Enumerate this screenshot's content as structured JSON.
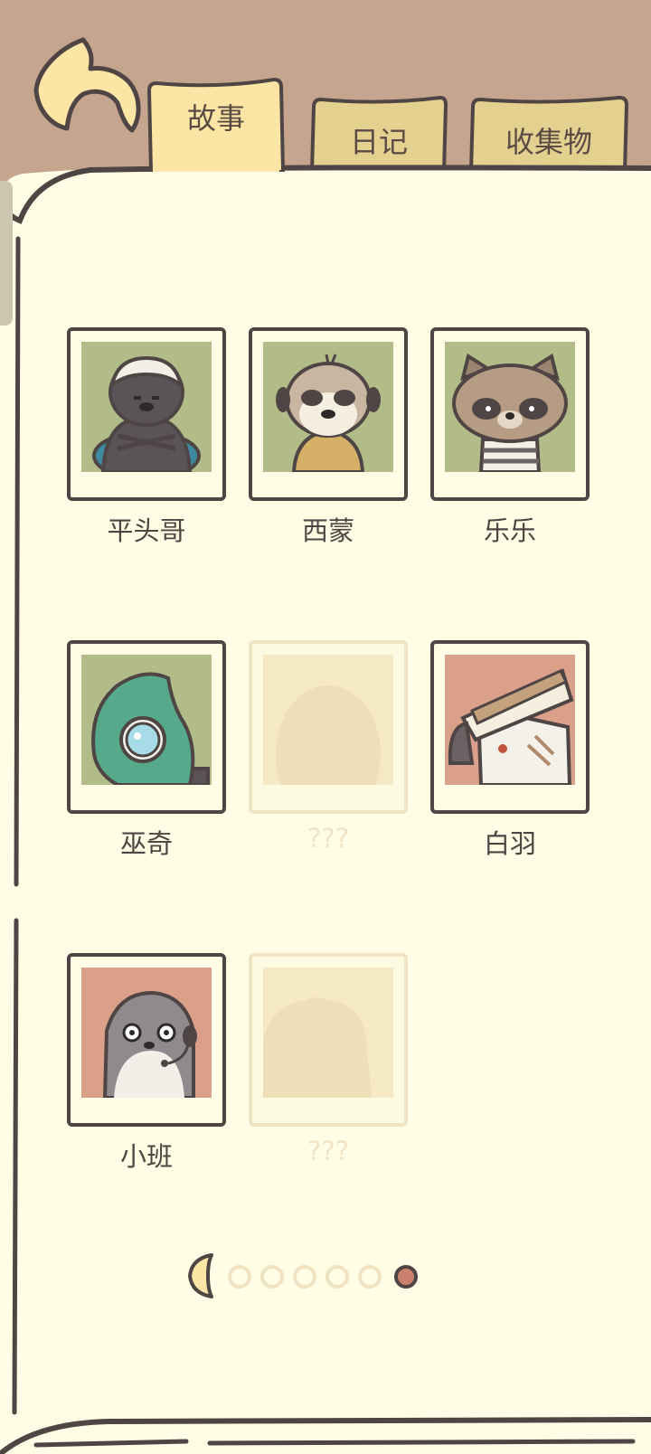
{
  "tabs": {
    "story_label": "故事",
    "diary_label": "日记",
    "collection_label": "收集物"
  },
  "characters": [
    {
      "name": "平头哥",
      "portrait": "honey-badger",
      "unlocked": true
    },
    {
      "name": "西蒙",
      "portrait": "meerkat",
      "unlocked": true
    },
    {
      "name": "乐乐",
      "portrait": "raccoon",
      "unlocked": true
    },
    {
      "name": "巫奇",
      "portrait": "chameleon",
      "unlocked": true
    },
    {
      "name": "???",
      "portrait": "locked-silhouette",
      "unlocked": false
    },
    {
      "name": "白羽",
      "portrait": "crane-with-hat",
      "unlocked": true
    },
    {
      "name": "小班",
      "portrait": "otter-with-headset",
      "unlocked": true
    },
    {
      "name": "???",
      "portrait": "locked-silhouette",
      "unlocked": false
    }
  ],
  "pager": {
    "total_pages": 6,
    "current_page": 6
  },
  "colors": {
    "header_bg": "#c5a58e",
    "page_bg": "#fffde6",
    "outline": "#4e4544",
    "tab_active": "#fde5a6",
    "tab_inactive": "#e5d18f",
    "portrait_green": "#b1bc88",
    "portrait_salmon": "#dba08a",
    "active_dot": "#cc8170"
  }
}
